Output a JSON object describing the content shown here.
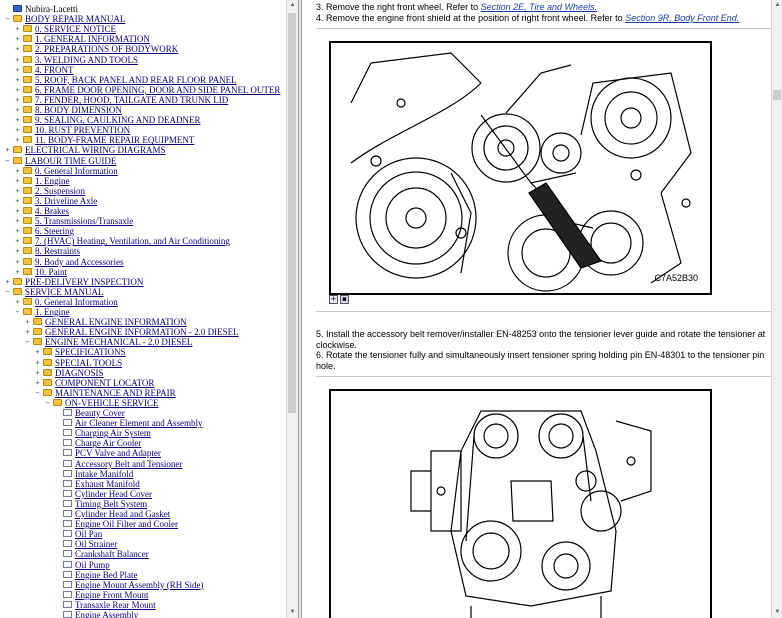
{
  "tree": [
    {
      "label": "Nubira-Lacetti",
      "type": "book",
      "level": 0,
      "toggle": "",
      "link": false
    },
    {
      "label": "BODY REPAIR MANUAL",
      "type": "folder",
      "level": 0,
      "toggle": "−",
      "link": true
    },
    {
      "label": "0. SERVICE NOTICE",
      "type": "folder",
      "level": 1,
      "toggle": "+",
      "link": true
    },
    {
      "label": "1. GENERAL INFORMATION",
      "type": "folder",
      "level": 1,
      "toggle": "+",
      "link": true
    },
    {
      "label": "2. PREPARATIONS OF BODYWORK",
      "type": "folder",
      "level": 1,
      "toggle": "+",
      "link": true
    },
    {
      "label": "3. WELDING AND TOOLS",
      "type": "folder",
      "level": 1,
      "toggle": "+",
      "link": true
    },
    {
      "label": "4. FRONT",
      "type": "folder",
      "level": 1,
      "toggle": "+",
      "link": true
    },
    {
      "label": "5. ROOF, BACK PANEL AND REAR FLOOR PANEL",
      "type": "folder",
      "level": 1,
      "toggle": "+",
      "link": true
    },
    {
      "label": "6. FRAME DOOR OPENING, DOOR AND SIDE PANEL OUTER",
      "type": "folder",
      "level": 1,
      "toggle": "+",
      "link": true
    },
    {
      "label": "7. FENDER, HOOD, TAILGATE AND TRUNK LID",
      "type": "folder",
      "level": 1,
      "toggle": "+",
      "link": true
    },
    {
      "label": "8. BODY DIMENSION",
      "type": "folder",
      "level": 1,
      "toggle": "+",
      "link": true
    },
    {
      "label": "9. SEALING, CAULKING AND DEADNER",
      "type": "folder",
      "level": 1,
      "toggle": "+",
      "link": true
    },
    {
      "label": "10. RUST PREVENTION",
      "type": "folder",
      "level": 1,
      "toggle": "+",
      "link": true
    },
    {
      "label": "11. BODY-FRAME REPAIR EQUIPMENT",
      "type": "folder",
      "level": 1,
      "toggle": "+",
      "link": true
    },
    {
      "label": "ELECTRICAL WIRING DIAGRAMS",
      "type": "folder",
      "level": 0,
      "toggle": "+",
      "link": true
    },
    {
      "label": "LABOUR TIME GUIDE",
      "type": "folder",
      "level": 0,
      "toggle": "−",
      "link": true
    },
    {
      "label": "0. General Information",
      "type": "folder",
      "level": 1,
      "toggle": "+",
      "link": true
    },
    {
      "label": "1. Engine",
      "type": "folder",
      "level": 1,
      "toggle": "+",
      "link": true
    },
    {
      "label": "2. Suspension",
      "type": "folder",
      "level": 1,
      "toggle": "+",
      "link": true
    },
    {
      "label": "3. Driveline Axle",
      "type": "folder",
      "level": 1,
      "toggle": "+",
      "link": true
    },
    {
      "label": "4. Brakes",
      "type": "folder",
      "level": 1,
      "toggle": "+",
      "link": true
    },
    {
      "label": "5. Transmissions/Transaxle",
      "type": "folder",
      "level": 1,
      "toggle": "+",
      "link": true
    },
    {
      "label": "6. Steering",
      "type": "folder",
      "level": 1,
      "toggle": "+",
      "link": true
    },
    {
      "label": "7. (HVAC) Heating, Ventilation, and Air Conditioning",
      "type": "folder",
      "level": 1,
      "toggle": "+",
      "link": true
    },
    {
      "label": "8. Restraints",
      "type": "folder",
      "level": 1,
      "toggle": "+",
      "link": true
    },
    {
      "label": "9. Body and Accessories",
      "type": "folder",
      "level": 1,
      "toggle": "+",
      "link": true
    },
    {
      "label": "10. Paint",
      "type": "folder",
      "level": 1,
      "toggle": "+",
      "link": true
    },
    {
      "label": "PRE-DELIVERY INSPECTION",
      "type": "folder",
      "level": 0,
      "toggle": "+",
      "link": true
    },
    {
      "label": "SERVICE MANUAL",
      "type": "folder",
      "level": 0,
      "toggle": "−",
      "link": true
    },
    {
      "label": "0. General Information",
      "type": "folder",
      "level": 1,
      "toggle": "+",
      "link": true
    },
    {
      "label": "1. Engine",
      "type": "folder",
      "level": 1,
      "toggle": "−",
      "link": true
    },
    {
      "label": "GENERAL ENGINE INFORMATION",
      "type": "folder",
      "level": 2,
      "toggle": "+",
      "link": true
    },
    {
      "label": "GENERAL ENGINE INFORMATION - 2.0 DIESEL",
      "type": "folder",
      "level": 2,
      "toggle": "+",
      "link": true
    },
    {
      "label": "ENGINE MECHANICAL - 2.0 DIESEL",
      "type": "folder",
      "level": 2,
      "toggle": "−",
      "link": true
    },
    {
      "label": "SPECIFICATIONS",
      "type": "folder",
      "level": 3,
      "toggle": "+",
      "link": true
    },
    {
      "label": "SPECIAL TOOLS",
      "type": "folder",
      "level": 3,
      "toggle": "+",
      "link": true
    },
    {
      "label": "DIAGNOSIS",
      "type": "folder",
      "level": 3,
      "toggle": "+",
      "link": true
    },
    {
      "label": "COMPONENT LOCATOR",
      "type": "folder",
      "level": 3,
      "toggle": "+",
      "link": true
    },
    {
      "label": "MAINTENANCE AND REPAIR",
      "type": "folder",
      "level": 3,
      "toggle": "−",
      "link": true
    },
    {
      "label": "ON-VEHICLE SERVICE",
      "type": "folder",
      "level": 4,
      "toggle": "−",
      "link": true
    },
    {
      "label": "Beauty Cover",
      "type": "page",
      "level": 5,
      "toggle": "",
      "link": true
    },
    {
      "label": "Air Cleaner Element and Assembly",
      "type": "page",
      "level": 5,
      "toggle": "",
      "link": true
    },
    {
      "label": "Charging Air System",
      "type": "page",
      "level": 5,
      "toggle": "",
      "link": true
    },
    {
      "label": "Charge Air Cooler",
      "type": "page",
      "level": 5,
      "toggle": "",
      "link": true
    },
    {
      "label": "PCV Valve and Adapter",
      "type": "page",
      "level": 5,
      "toggle": "",
      "link": true
    },
    {
      "label": "Accessory Belt and Tensioner",
      "type": "page",
      "level": 5,
      "toggle": "",
      "link": true
    },
    {
      "label": "Intake Manifold",
      "type": "page",
      "level": 5,
      "toggle": "",
      "link": true
    },
    {
      "label": "Exhaust Manifold",
      "type": "page",
      "level": 5,
      "toggle": "",
      "link": true
    },
    {
      "label": "Cylinder Head Cover",
      "type": "page",
      "level": 5,
      "toggle": "",
      "link": true
    },
    {
      "label": "Timing Belt System",
      "type": "page",
      "level": 5,
      "toggle": "",
      "link": true
    },
    {
      "label": "Cylinder Head and Gasket",
      "type": "page",
      "level": 5,
      "toggle": "",
      "link": true
    },
    {
      "label": "Engine Oil Filter and Cooler",
      "type": "page",
      "level": 5,
      "toggle": "",
      "link": true
    },
    {
      "label": "Oil Pan",
      "type": "page",
      "level": 5,
      "toggle": "",
      "link": true
    },
    {
      "label": "Oil Strainer",
      "type": "page",
      "level": 5,
      "toggle": "",
      "link": true
    },
    {
      "label": "Crankshaft Balancer",
      "type": "page",
      "level": 5,
      "toggle": "",
      "link": true
    },
    {
      "label": "Oil Pump",
      "type": "page",
      "level": 5,
      "toggle": "",
      "link": true
    },
    {
      "label": "Engine Bed Plate",
      "type": "page",
      "level": 5,
      "toggle": "",
      "link": true
    },
    {
      "label": "Engine Mount Assembly (RH Side)",
      "type": "page",
      "level": 5,
      "toggle": "",
      "link": true
    },
    {
      "label": "Engine Front Mount",
      "type": "page",
      "level": 5,
      "toggle": "",
      "link": true
    },
    {
      "label": "Transaxle Rear Mount",
      "type": "page",
      "level": 5,
      "toggle": "",
      "link": true
    },
    {
      "label": "Engine Assembly",
      "type": "page",
      "level": 5,
      "toggle": "",
      "link": true
    }
  ],
  "content": {
    "step3": {
      "text": "3. Remove the right front wheel. Refer to ",
      "link": "Section 2E, Tire and Wheels."
    },
    "step4": {
      "text": "4. Remove the engine front shield at the position of right front wheel. Refer to ",
      "link": "Section 9R, Body Front End."
    },
    "figure1_code": "C7A52B30",
    "step5": "5.  Install the accessory belt remover/installer EN-48253 onto the tensioner lever guide and rotate the tensioner at clockwise.",
    "step6": "6.  Rotate the tensioner fully and simultaneously insert tensioner spring holding pin EN-48301 to the tensioner pin hole."
  },
  "colors": {
    "link": "#0b0080",
    "content_link": "#1a3fa8",
    "folder": "#f2c43c"
  }
}
